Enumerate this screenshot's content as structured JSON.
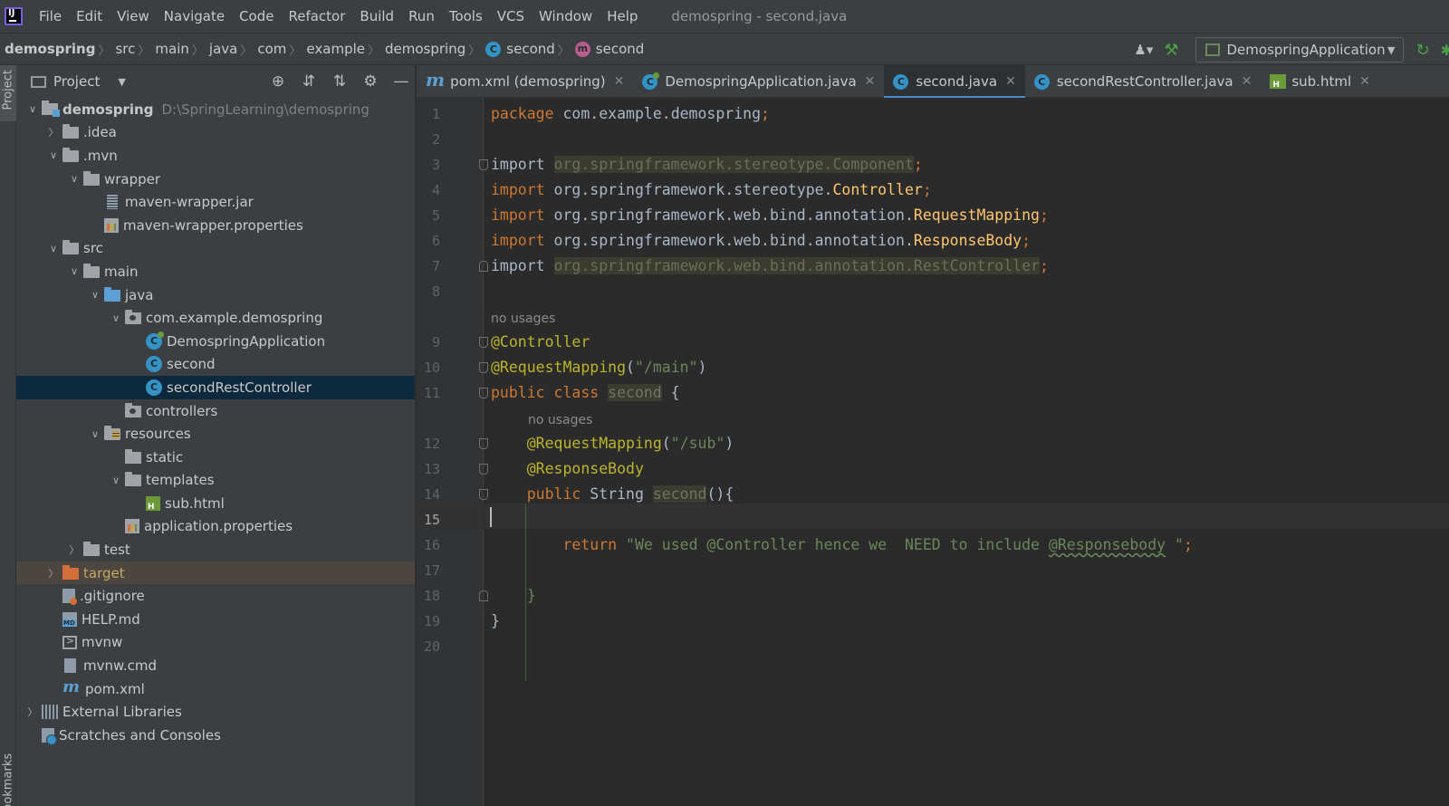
{
  "menu": {
    "items": [
      "File",
      "Edit",
      "View",
      "Navigate",
      "Code",
      "Refactor",
      "Build",
      "Run",
      "Tools",
      "VCS",
      "Window",
      "Help"
    ],
    "window_title": "demospring - second.java"
  },
  "breadcrumbs": {
    "project": "demospring",
    "parts": [
      "src",
      "main",
      "java",
      "com",
      "example",
      "demospring"
    ],
    "class_name": "second",
    "method_name": "second"
  },
  "run_config": {
    "label": "DemospringApplication"
  },
  "stripe": {
    "project": "Project",
    "bookmarks": "Bookmarks"
  },
  "project_panel": {
    "title": "Project",
    "tree": [
      {
        "label": "demospring",
        "path": "D:\\SpringLearning\\demospring",
        "depth": 0,
        "arrow": "open",
        "icon": "module",
        "bold": true
      },
      {
        "label": ".idea",
        "depth": 1,
        "arrow": "closed",
        "icon": "folder"
      },
      {
        "label": ".mvn",
        "depth": 1,
        "arrow": "open",
        "icon": "folder"
      },
      {
        "label": "wrapper",
        "depth": 2,
        "arrow": "open",
        "icon": "folder"
      },
      {
        "label": "maven-wrapper.jar",
        "depth": 3,
        "arrow": "none",
        "icon": "jar"
      },
      {
        "label": "maven-wrapper.properties",
        "depth": 3,
        "arrow": "none",
        "icon": "props"
      },
      {
        "label": "src",
        "depth": 1,
        "arrow": "open",
        "icon": "folder"
      },
      {
        "label": "main",
        "depth": 2,
        "arrow": "open",
        "icon": "folder"
      },
      {
        "label": "java",
        "depth": 3,
        "arrow": "open",
        "icon": "folder blue"
      },
      {
        "label": "com.example.demospring",
        "depth": 4,
        "arrow": "open",
        "icon": "folder pkg"
      },
      {
        "label": "DemospringApplication",
        "depth": 5,
        "arrow": "none",
        "icon": "classc spring"
      },
      {
        "label": "second",
        "depth": 5,
        "arrow": "none",
        "icon": "classc"
      },
      {
        "label": "secondRestController",
        "depth": 5,
        "arrow": "none",
        "icon": "classc",
        "selected": true
      },
      {
        "label": "controllers",
        "depth": 4,
        "arrow": "none",
        "icon": "folder pkg"
      },
      {
        "label": "resources",
        "depth": 3,
        "arrow": "open",
        "icon": "folder res"
      },
      {
        "label": "static",
        "depth": 4,
        "arrow": "none",
        "icon": "folder"
      },
      {
        "label": "templates",
        "depth": 4,
        "arrow": "open",
        "icon": "folder"
      },
      {
        "label": "sub.html",
        "depth": 5,
        "arrow": "none",
        "icon": "html"
      },
      {
        "label": "application.properties",
        "depth": 4,
        "arrow": "none",
        "icon": "props"
      },
      {
        "label": "test",
        "depth": 2,
        "arrow": "closed",
        "icon": "folder"
      },
      {
        "label": "target",
        "depth": 1,
        "arrow": "closed",
        "icon": "folder orange",
        "excluded": true
      },
      {
        "label": ".gitignore",
        "depth": 1,
        "arrow": "none",
        "icon": "gitignore"
      },
      {
        "label": "HELP.md",
        "depth": 1,
        "arrow": "none",
        "icon": "md"
      },
      {
        "label": "mvnw",
        "depth": 1,
        "arrow": "none",
        "icon": "shell"
      },
      {
        "label": "mvnw.cmd",
        "depth": 1,
        "arrow": "none",
        "icon": "file"
      },
      {
        "label": "pom.xml",
        "depth": 1,
        "arrow": "none",
        "icon": "maven"
      },
      {
        "label": "External Libraries",
        "depth": 0,
        "arrow": "closed",
        "icon": "libs"
      },
      {
        "label": "Scratches and Consoles",
        "depth": 0,
        "arrow": "none",
        "icon": "scratch"
      }
    ]
  },
  "tabs": [
    {
      "label": "pom.xml (demospring)",
      "icon": "maven"
    },
    {
      "label": "DemospringApplication.java",
      "icon": "class-spring"
    },
    {
      "label": "second.java",
      "icon": "class",
      "active": true
    },
    {
      "label": "secondRestController.java",
      "icon": "class"
    },
    {
      "label": "sub.html",
      "icon": "html"
    }
  ],
  "editor": {
    "current_line": "15",
    "hints": {
      "no_usages": "no usages"
    },
    "lines": [
      {
        "n": "1",
        "tokens": [
          [
            "kw",
            "package "
          ],
          [
            "",
            "com.example.demospring"
          ],
          [
            "punc",
            ";"
          ]
        ]
      },
      {
        "n": "2",
        "tokens": []
      },
      {
        "n": "3",
        "tokens": [
          [
            "",
            "import "
          ],
          [
            "unused",
            "org.springframework.stereotype.Component"
          ],
          [
            "unusedpunc",
            ";"
          ]
        ]
      },
      {
        "n": "4",
        "tokens": [
          [
            "kw",
            "import "
          ],
          [
            "",
            "org.springframework.stereotype."
          ],
          [
            "cls",
            "Controller"
          ],
          [
            "punc",
            ";"
          ]
        ]
      },
      {
        "n": "5",
        "tokens": [
          [
            "kw",
            "import "
          ],
          [
            "",
            "org.springframework.web.bind.annotation."
          ],
          [
            "cls",
            "RequestMapping"
          ],
          [
            "punc",
            ";"
          ]
        ]
      },
      {
        "n": "6",
        "tokens": [
          [
            "kw",
            "import "
          ],
          [
            "",
            "org.springframework.web.bind.annotation."
          ],
          [
            "cls",
            "ResponseBody"
          ],
          [
            "punc",
            ";"
          ]
        ]
      },
      {
        "n": "7",
        "tokens": [
          [
            "",
            "import "
          ],
          [
            "unused",
            "org.springframework.web.bind.annotation.RestController"
          ],
          [
            "unusedpunc",
            ";"
          ]
        ]
      },
      {
        "n": "8",
        "tokens": []
      },
      {
        "n": "9",
        "tokens": [
          [
            "ann",
            "@Controller"
          ]
        ]
      },
      {
        "n": "10",
        "tokens": [
          [
            "ann",
            "@RequestMapping"
          ],
          [
            "",
            "("
          ],
          [
            "str",
            "\"/main\""
          ],
          [
            "",
            ")"
          ]
        ]
      },
      {
        "n": "11",
        "tokens": [
          [
            "kw",
            "public class "
          ],
          [
            "selword",
            "second"
          ],
          [
            "",
            " {"
          ]
        ]
      },
      {
        "n": "12",
        "tokens": [
          [
            "",
            "    "
          ],
          [
            "ann",
            "@RequestMapping"
          ],
          [
            "",
            "("
          ],
          [
            "str",
            "\"/sub\""
          ],
          [
            "",
            ")"
          ]
        ]
      },
      {
        "n": "13",
        "tokens": [
          [
            "",
            "    "
          ],
          [
            "ann",
            "@ResponseBody"
          ]
        ]
      },
      {
        "n": "14",
        "tokens": [
          [
            "",
            "    "
          ],
          [
            "kw",
            "public "
          ],
          [
            "",
            "String "
          ],
          [
            "methodhl",
            "second"
          ],
          [
            "",
            "(){"
          ]
        ]
      },
      {
        "n": "15",
        "tokens": []
      },
      {
        "n": "16",
        "tokens": [
          [
            "",
            "        "
          ],
          [
            "kw",
            "return "
          ],
          [
            "str",
            "\"We used @Controller hence we  NEED to include "
          ],
          [
            "strtypo",
            "@Responsebody"
          ],
          [
            "str",
            " \""
          ],
          [
            "punc",
            ";"
          ]
        ]
      },
      {
        "n": "17",
        "tokens": []
      },
      {
        "n": "18",
        "tokens": [
          [
            "",
            "    "
          ],
          [
            "str",
            "}"
          ]
        ]
      },
      {
        "n": "19",
        "tokens": [
          [
            "",
            "}"
          ]
        ]
      },
      {
        "n": "20",
        "tokens": []
      }
    ]
  },
  "colors": {
    "keyword": "#cc7832",
    "string": "#6a8759",
    "annotation": "#bbb529",
    "class": "#ffc66d",
    "selection": "#0d293e",
    "tab_underline": "#4a88c7"
  }
}
